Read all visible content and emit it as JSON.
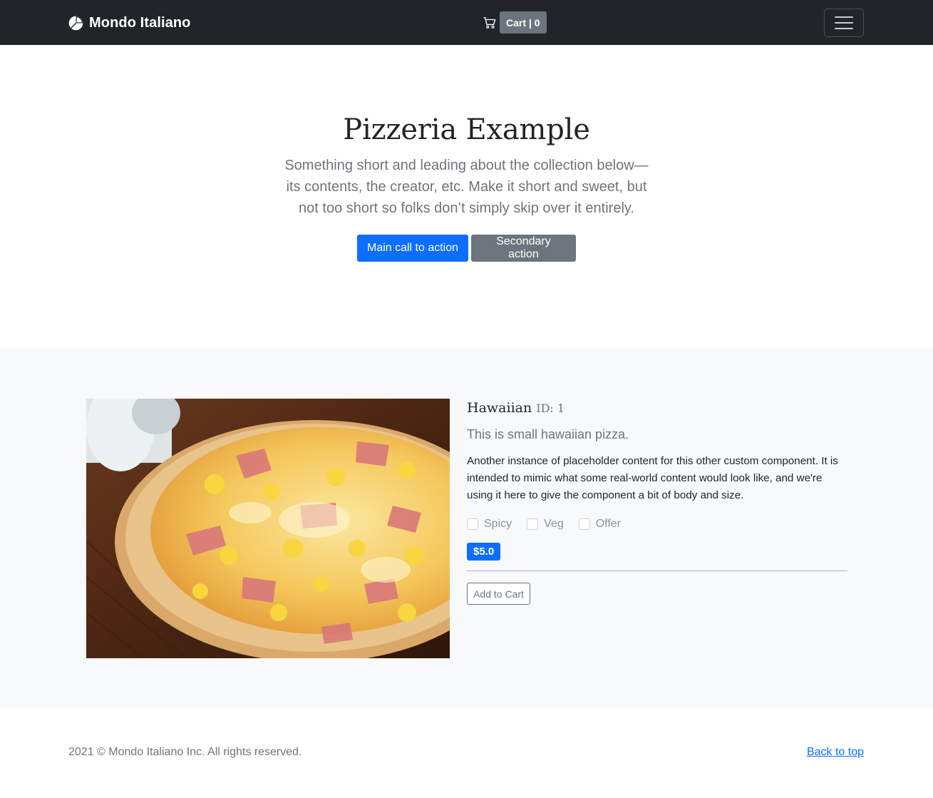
{
  "navbar": {
    "brand": "Mondo Italiano",
    "brand_icon": "pie-chart-icon",
    "cart_icon": "cart-icon",
    "cart_label": "Cart | 0",
    "menu_icon": "hamburger-menu-icon"
  },
  "hero": {
    "title": "Pizzeria Example",
    "lead": "Something short and leading about the collection below—its contents, the creator, etc. Make it short and sweet, but not too short so folks don’t simply skip over it entirely.",
    "primary_button": "Main call to action",
    "secondary_button": "Secondary action"
  },
  "product": {
    "name": "Hawaiian",
    "id_label": "ID: 1",
    "subtitle": "This is small hawaiian pizza.",
    "description": "Another instance of placeholder content for this other custom component. It is intended to mimic what some real-world content would look like, and we're using it here to give the component a bit of body and size.",
    "options": [
      {
        "label": "Spicy",
        "checked": false
      },
      {
        "label": "Veg",
        "checked": false
      },
      {
        "label": "Offer",
        "checked": false
      }
    ],
    "price": "$5.0",
    "add_button": "Add to Cart"
  },
  "footer": {
    "copyright": "2021 © Mondo Italiano Inc. All rights reserved.",
    "back_to_top": "Back to top"
  },
  "colors": {
    "navbar": "#212529",
    "primary": "#0d6efd",
    "secondary": "#6c757d",
    "section_bg": "#f8f9fa"
  }
}
